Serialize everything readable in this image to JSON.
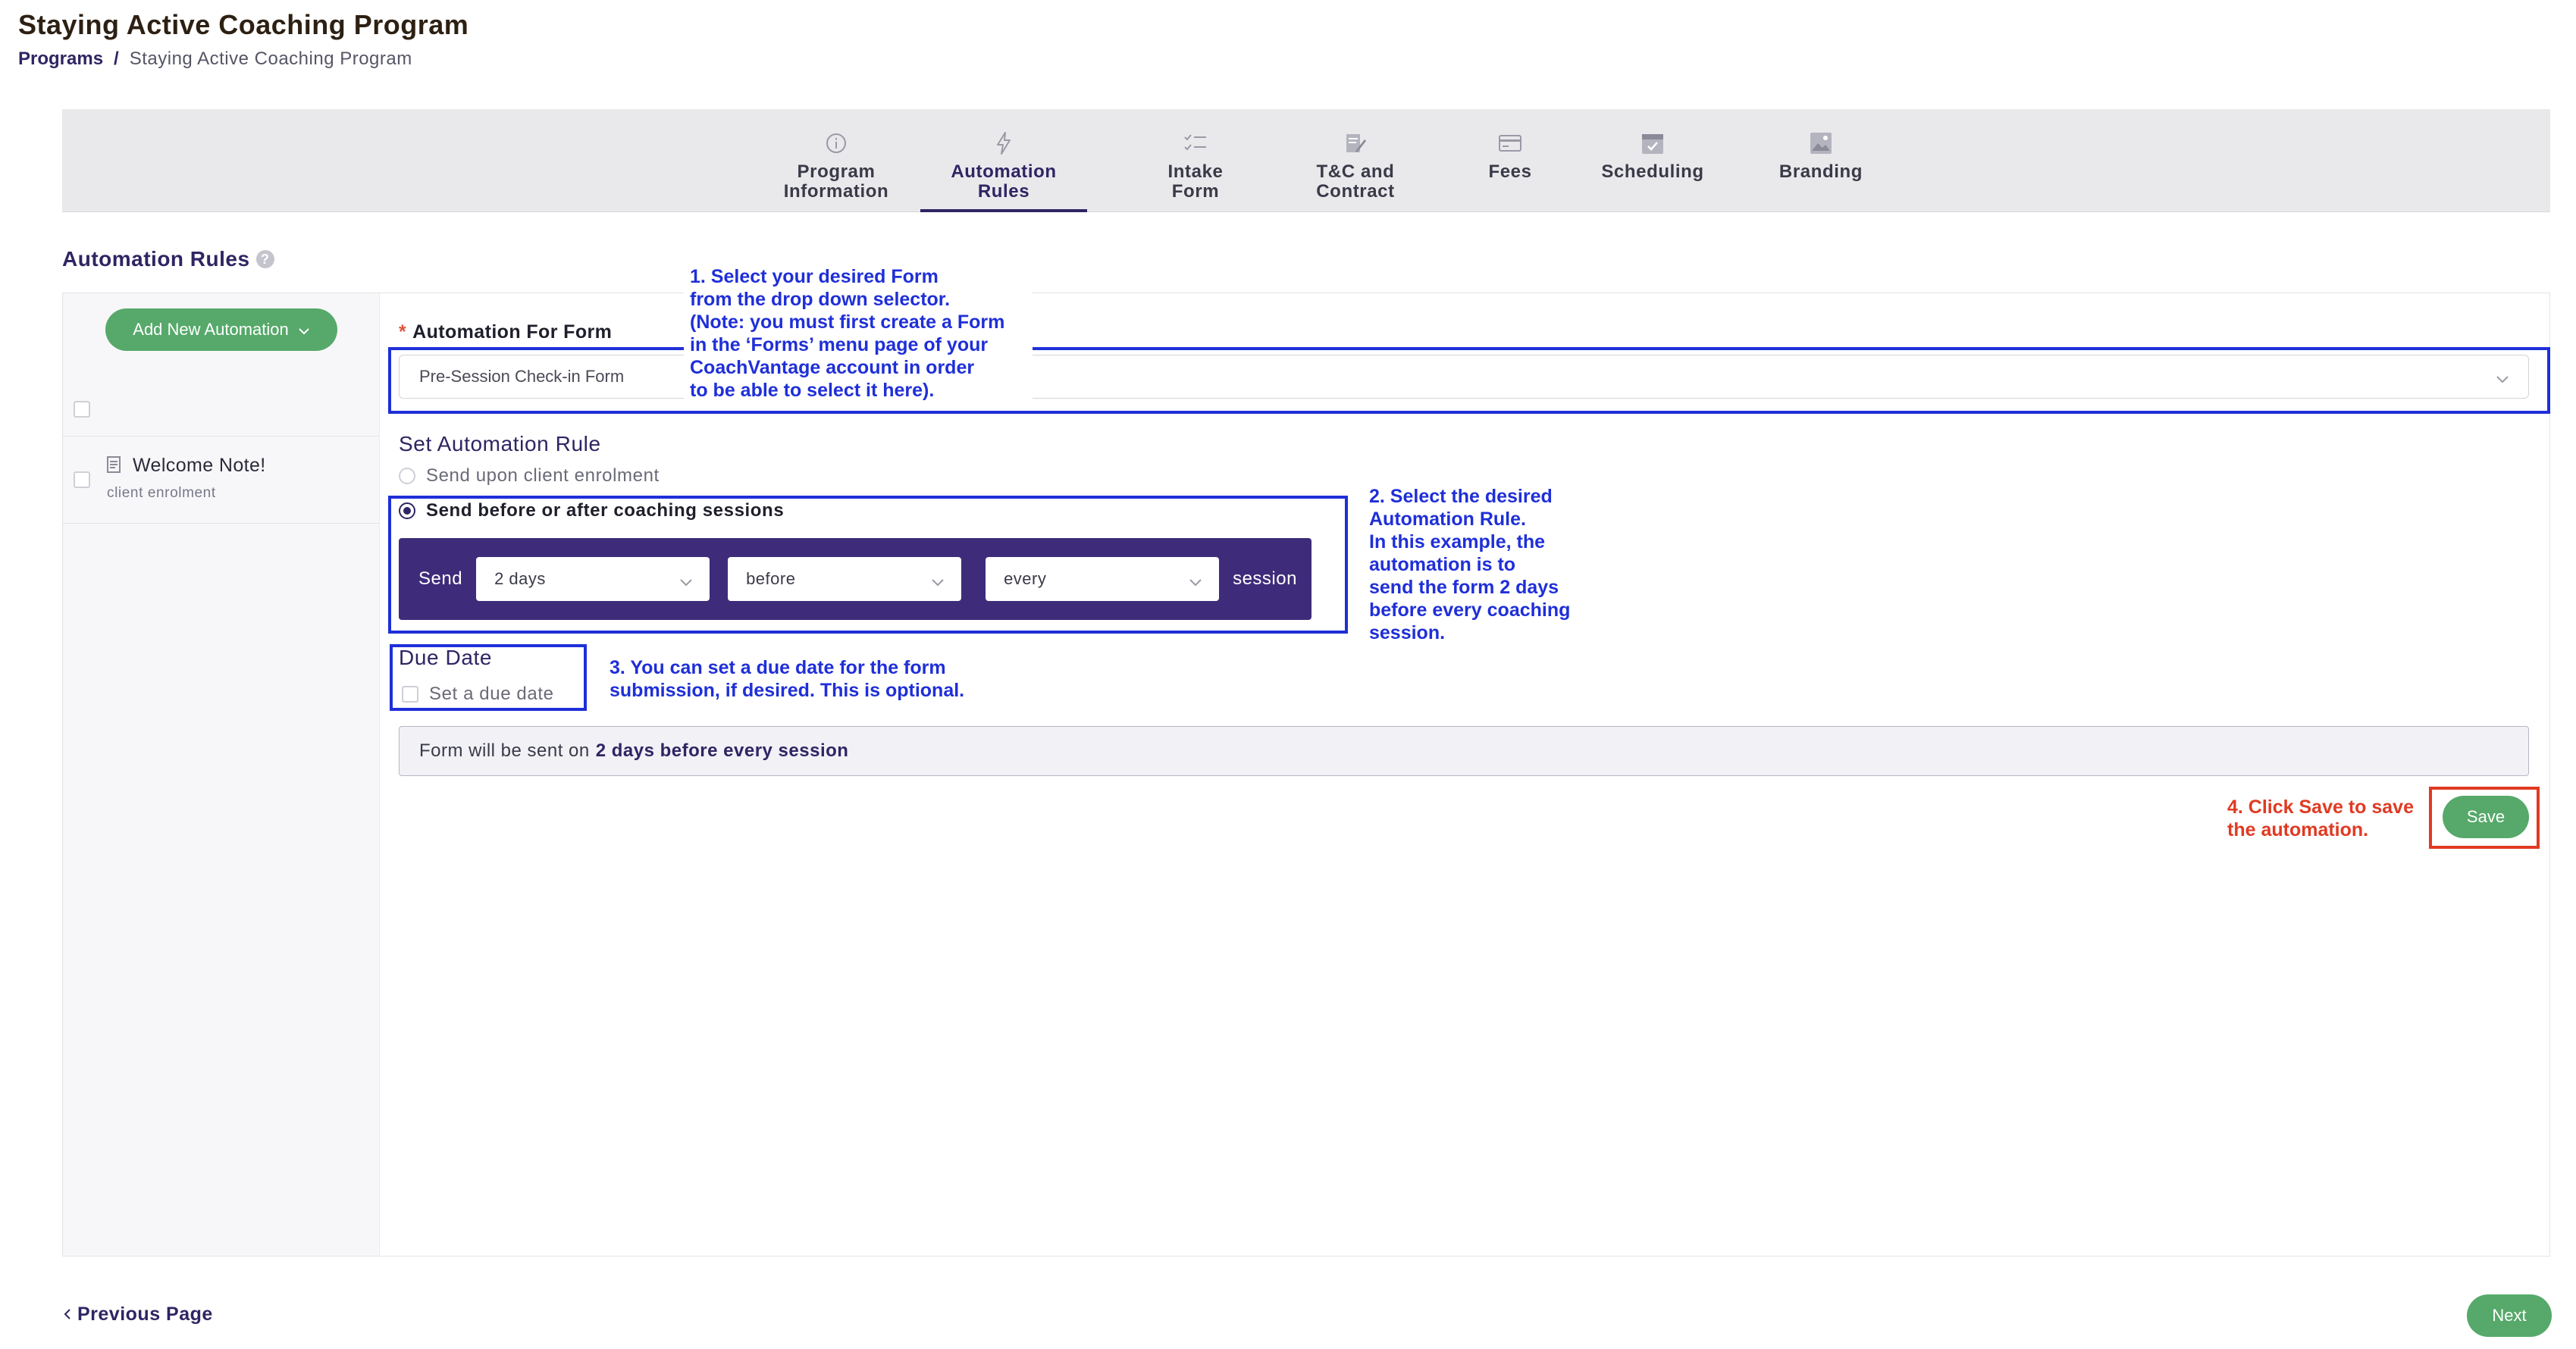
{
  "page": {
    "title": "Staying Active Coaching Program"
  },
  "breadcrumb": {
    "root": "Programs",
    "separator": "/",
    "current": "Staying Active Coaching Program"
  },
  "tabs": [
    {
      "label": "Program\nInformation",
      "icon": "info-icon"
    },
    {
      "label": "Automation\nRules",
      "icon": "lightning-icon",
      "active": true
    },
    {
      "label": "Intake\nForm",
      "icon": "checklist-icon"
    },
    {
      "label": "T&C and\nContract",
      "icon": "contract-edit-icon"
    },
    {
      "label": "Fees",
      "icon": "credit-card-icon"
    },
    {
      "label": "Scheduling",
      "icon": "calendar-icon"
    },
    {
      "label": "Branding",
      "icon": "image-icon"
    }
  ],
  "section": {
    "title": "Automation Rules",
    "help": "?"
  },
  "sidebar": {
    "add_button": "Add New Automation",
    "rules": [
      {
        "name": "Welcome Note!",
        "trigger": "client enrolment"
      }
    ]
  },
  "form": {
    "required_mark": "*",
    "automation_for_form_label": "Automation For Form",
    "selected_form": "Pre-Session Check-in Form",
    "set_rule_title": "Set Automation Rule",
    "rule_options": [
      {
        "label": "Send upon client enrolment",
        "selected": false
      },
      {
        "label": "Send before or after coaching sessions",
        "selected": true
      }
    ],
    "send_prefix": "Send",
    "send_suffix": "session",
    "offset_value": "2 days",
    "timing_value": "before",
    "frequency_value": "every",
    "due_date_title": "Due Date",
    "due_date_checkbox": "Set a due date",
    "summary_prefix": "Form will be sent on",
    "summary_value": "2 days before every session",
    "save_button": "Save"
  },
  "annotations": {
    "step1": "1. Select your desired Form\nfrom the drop down selector.\n(Note: you must first create a Form\nin the ‘Forms’ menu page of your\nCoachVantage account in order\nto be able to select it here).",
    "step2": "2. Select the desired\nAutomation Rule.\nIn this example, the\nautomation is to\nsend the form 2 days\nbefore every coaching\nsession.",
    "step3": "3. You can set a due date for the form\nsubmission, if desired. This is optional.",
    "step4": "4. Click Save to save\nthe automation."
  },
  "footer": {
    "previous": "Previous Page",
    "next": "Next"
  },
  "colors": {
    "brand_purple": "#2f2563",
    "send_bar": "#3e2c7a",
    "green_button": "#56a96a",
    "annotation_blue": "#1f2fd8",
    "annotation_red": "#e03a22"
  }
}
